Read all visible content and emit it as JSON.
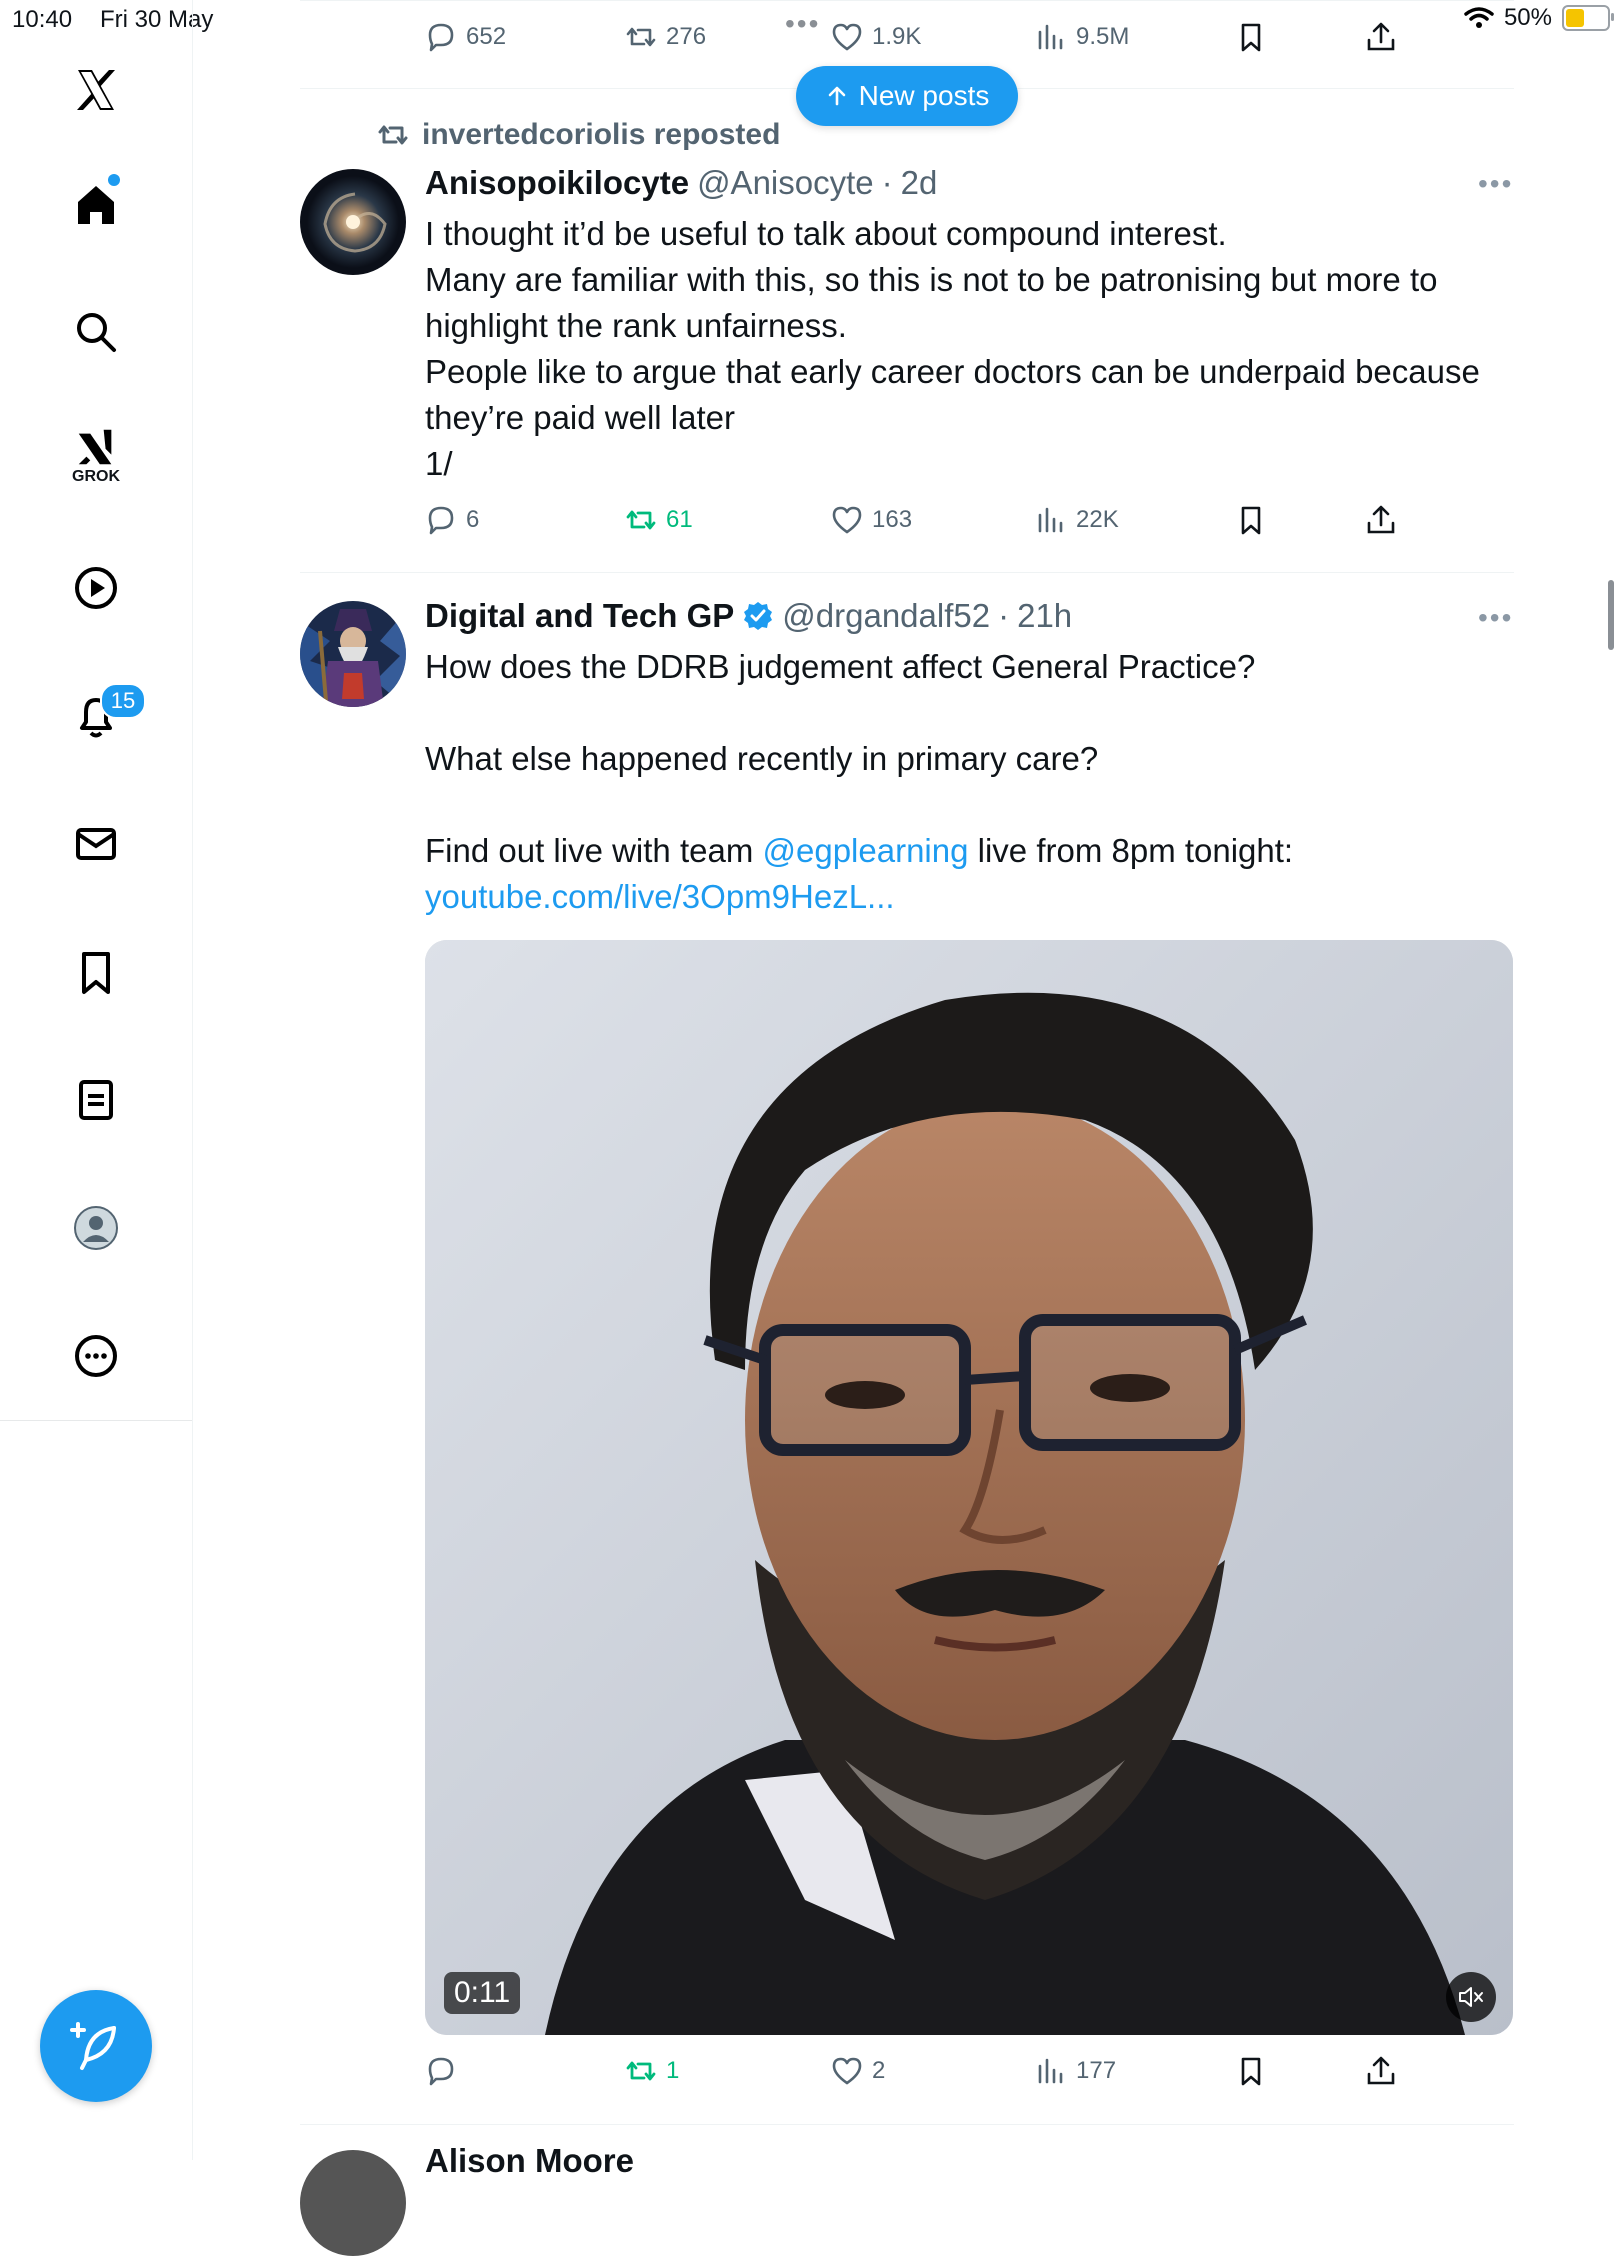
{
  "status": {
    "time": "10:40",
    "date": "Fri 30 May",
    "battery": "50%",
    "battery_level": 0.5
  },
  "top_post_actions": {
    "replies": "652",
    "reposts": "276",
    "likes": "1.9K",
    "views": "9.5M"
  },
  "new_posts": {
    "label": "New posts"
  },
  "sidebar": {
    "grok_label": "GROK",
    "notifications_count": "15"
  },
  "post1": {
    "repost_by": "invertedcoriolis reposted",
    "name": "Anisopoikilocyte",
    "handle": "@Anisocyte",
    "sep": "·",
    "time": "2d",
    "lines": [
      "I thought it’d be useful to talk about compound interest.",
      "Many are familiar with this, so this is not to be patronising but more to",
      "highlight the rank unfairness.",
      "People like to argue that early career doctors can be underpaid because",
      "they’re paid well later",
      "1/"
    ],
    "replies": "6",
    "reposts": "61",
    "likes": "163",
    "views": "22K"
  },
  "post2": {
    "name": "Digital and Tech GP",
    "handle": "@drgandalf52",
    "sep": "·",
    "time": "21h",
    "line1": "How does the DDRB judgement affect General Practice?",
    "line2": "What else happened recently in primary care?",
    "line3_pre": "Find out live with team ",
    "line3_mention": "@egplearning",
    "line3_post": " live from 8pm tonight:",
    "link": "youtube.com/live/3Opm9HezL...",
    "video_time": "0:11",
    "replies": "",
    "reposts": "1",
    "likes": "2",
    "views": "177"
  },
  "next_post": {
    "name_partial": "Alison Moore"
  },
  "colors": {
    "accent": "#1d9bf0",
    "repost_green": "#00ba7c",
    "muted": "#536471"
  }
}
